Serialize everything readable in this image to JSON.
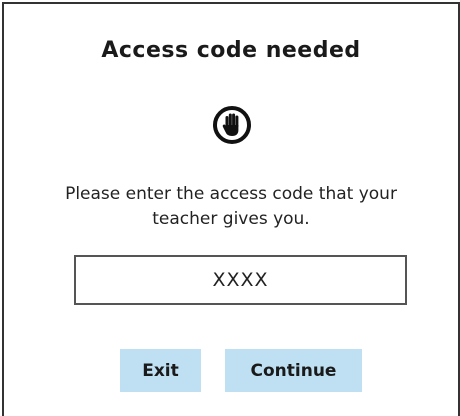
{
  "dialog": {
    "title": "Access code needed",
    "icon": "stop-hand-icon",
    "instructions_line1": "Please enter the access code that your",
    "instructions_line2": "teacher gives you.",
    "code_input": {
      "value": "",
      "placeholder": "XXXX"
    },
    "buttons": {
      "exit_label": "Exit",
      "continue_label": "Continue"
    }
  },
  "colors": {
    "button_background": "#bfe0f3",
    "border": "#333333",
    "text": "#1a1a1a"
  }
}
